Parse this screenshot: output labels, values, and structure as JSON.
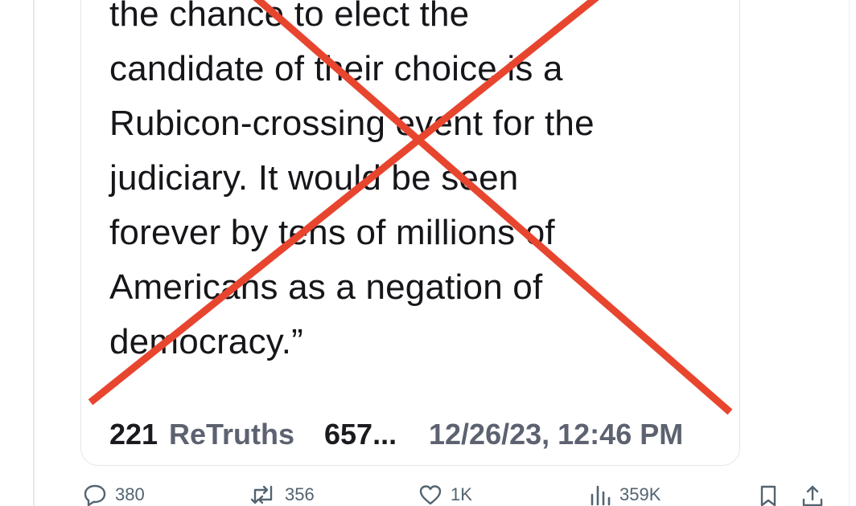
{
  "post": {
    "lines": [
      "the chance to elect the",
      "candidate of their choice is a",
      "Rubicon-crossing event for the",
      "judiciary. It would be seen",
      "forever by tens of millions of",
      "Americans as a negation of",
      "democracy.”"
    ],
    "retruths_count": "221",
    "retruths_label": "ReTruths",
    "likes_truncated": "657...",
    "timestamp": "12/26/23, 12:46 PM"
  },
  "overlay": {
    "cross_color": "#e8452f"
  },
  "actions": {
    "replies": "380",
    "reposts": "356",
    "likes": "1K",
    "views": "359K"
  },
  "icons": {
    "reply": "speech-bubble-icon",
    "repost": "repost-arrows-icon",
    "like": "heart-icon",
    "views": "bar-chart-icon",
    "bookmark": "bookmark-icon",
    "share": "share-upload-icon"
  }
}
